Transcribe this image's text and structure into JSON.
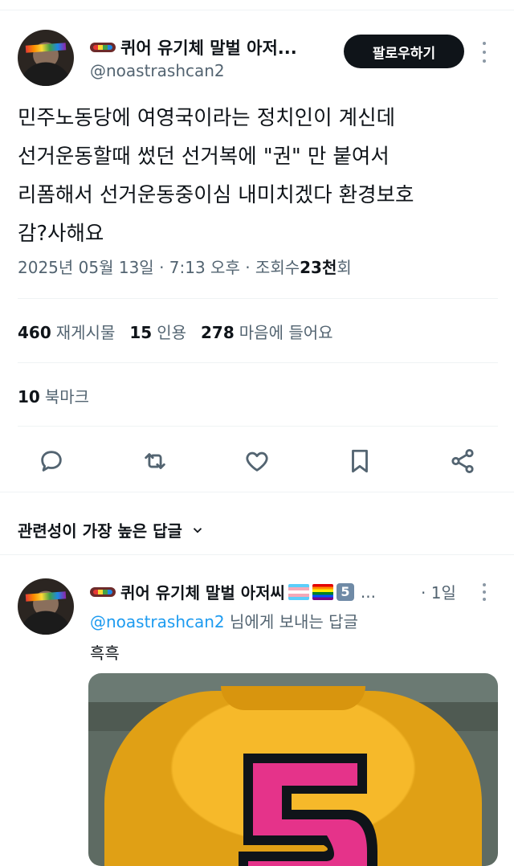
{
  "tweet": {
    "author": {
      "display_name": "퀴어 유기체 말벌 아저...",
      "handle": "@noastrashcan2",
      "avatar_icon": "avatar-photo"
    },
    "follow_label": "팔로우하기",
    "text": "민주노동당에 여영국이라는 정치인이 계신데\n선거운동할때 썼던 선거복에 \"권\" 만 붙여서\n리폼해서 선거운동중이심 내미치겠다 환경보호\n감?사해요",
    "meta": {
      "date": "2025년 05월 13일 · 7:13 오후 · 조회수 ",
      "views_number": "23천",
      "views_suffix": "회"
    },
    "stats": {
      "reposts_count": "460",
      "reposts_label": "재게시물",
      "quotes_count": "15",
      "quotes_label": "인용",
      "likes_count": "278",
      "likes_label": "마음에 들어요"
    },
    "bookmarks": {
      "count": "10",
      "label": "북마크"
    },
    "actions": [
      "reply-icon",
      "repost-icon",
      "like-icon",
      "bookmark-icon",
      "share-icon"
    ]
  },
  "replies_sort": {
    "label": "관련성이 가장 높은 답글"
  },
  "reply": {
    "display_name": "퀴어 유기체 말벌 아저씨",
    "badge_number": "5",
    "ellipsis": "...",
    "time": "· 1일",
    "reply_to_mention": "@noastrashcan2",
    "reply_to_suffix": " 님에게 보내는 답글",
    "text": "흑흑"
  },
  "colors": {
    "text_primary": "#0f1419",
    "text_secondary": "#536471",
    "accent": "#1d9bf0",
    "follow_bg": "#0f1419",
    "divider": "#eff3f4"
  }
}
